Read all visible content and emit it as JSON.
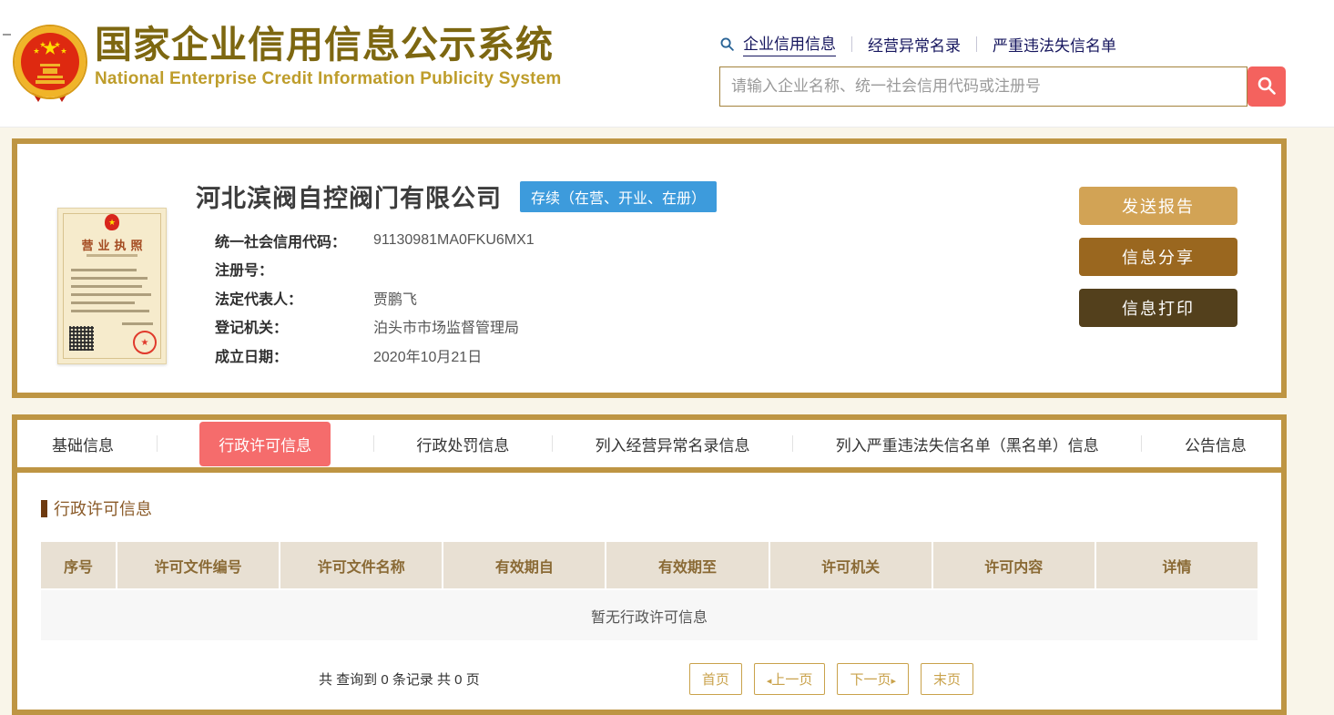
{
  "header": {
    "title_zh": "国家企业信用信息公示系统",
    "title_en": "National Enterprise Credit Information Publicity System",
    "nav": {
      "items": [
        {
          "label": "企业信用信息"
        },
        {
          "label": "经营异常名录"
        },
        {
          "label": "严重违法失信名单"
        }
      ]
    },
    "search": {
      "placeholder": "请输入企业名称、统一社会信用代码或注册号"
    }
  },
  "company": {
    "name": "河北滨阀自控阀门有限公司",
    "status": "存续（在营、开业、在册）",
    "license_title": "营业执照",
    "fields": [
      {
        "label": "统一社会信用代码：",
        "value": "91130981MA0FKU6MX1"
      },
      {
        "label": "注册号：",
        "value": ""
      },
      {
        "label": "法定代表人：",
        "value": "贾鹏飞"
      },
      {
        "label": "登记机关：",
        "value": "泊头市市场监督管理局"
      },
      {
        "label": "成立日期：",
        "value": "2020年10月21日"
      }
    ],
    "actions": [
      {
        "label": "发送报告",
        "color": "#D2A355"
      },
      {
        "label": "信息分享",
        "color": "#9A671F"
      },
      {
        "label": "信息打印",
        "color": "#53401C"
      }
    ]
  },
  "tabs": [
    {
      "label": "基础信息",
      "active": false
    },
    {
      "label": "行政许可信息",
      "active": true
    },
    {
      "label": "行政处罚信息",
      "active": false
    },
    {
      "label": "列入经营异常名录信息",
      "active": false
    },
    {
      "label": "列入严重违法失信名单（黑名单）信息",
      "active": false
    },
    {
      "label": "公告信息",
      "active": false
    }
  ],
  "section": {
    "title": "行政许可信息",
    "table": {
      "headers": [
        "序号",
        "许可文件编号",
        "许可文件名称",
        "有效期自",
        "有效期至",
        "许可机关",
        "许可内容",
        "详情"
      ],
      "rows": [],
      "empty_text": "暂无行政许可信息"
    },
    "pagination": {
      "summary": "共 查询到 0 条记录 共 0 页",
      "first": "首页",
      "prev": "上一页",
      "next": "下一页",
      "last": "末页",
      "prev_arrow": "◂",
      "next_arrow": "▸"
    }
  },
  "colors": {
    "gold_border": "#BE9543",
    "title_gold": "#7D6711",
    "subtitle_gold": "#BE9D2B",
    "search_button_red": "#F4625E",
    "tab_active_red": "#F56C6C",
    "status_badge_blue": "#3D9BDC",
    "table_header_bg": "#E8E0D3",
    "table_header_text": "#8A6A35",
    "pagination_gold": "#C9A24B",
    "page_background": "#F9F5E9"
  }
}
